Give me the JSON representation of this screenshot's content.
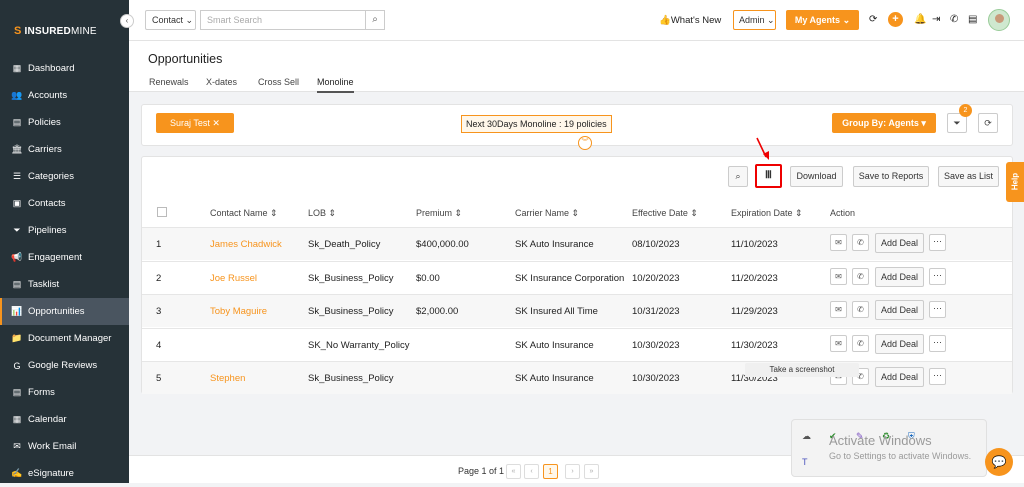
{
  "brand": {
    "mark": "S",
    "name_bold": "INSURED",
    "name_light": "MINE",
    "collapse_icon": "‹"
  },
  "sidebar": {
    "items": [
      {
        "label": "Dashboard",
        "icon": "▦"
      },
      {
        "label": "Accounts",
        "icon": "👥"
      },
      {
        "label": "Policies",
        "icon": "▤"
      },
      {
        "label": "Carriers",
        "icon": "🏛"
      },
      {
        "label": "Categories",
        "icon": "☰"
      },
      {
        "label": "Contacts",
        "icon": "▣"
      },
      {
        "label": "Pipelines",
        "icon": "⏷"
      },
      {
        "label": "Engagement",
        "icon": "📢"
      },
      {
        "label": "Tasklist",
        "icon": "▤"
      },
      {
        "label": "Opportunities",
        "icon": "📊",
        "active": true
      },
      {
        "label": "Document Manager",
        "icon": "📁"
      },
      {
        "label": "Google Reviews",
        "icon": "G"
      },
      {
        "label": "Forms",
        "icon": "▤"
      },
      {
        "label": "Calendar",
        "icon": "▦"
      },
      {
        "label": "Work Email",
        "icon": "✉"
      },
      {
        "label": "eSignature",
        "icon": "✍"
      }
    ]
  },
  "topbar": {
    "search_type": "Contact",
    "search_placeholder": "Smart Search",
    "whats_new": "👍What's New",
    "role": "Admin",
    "my_agents": "My Agents ⌄",
    "plus": "+"
  },
  "header": {
    "title": "Opportunities",
    "tabs": [
      "Renewals",
      "X-dates",
      "Cross Sell",
      "Monoline"
    ],
    "active_tab": "Monoline"
  },
  "filters": {
    "chip": "Suraj Test ✕",
    "info": "Next 30Days  Monoline : 19 policies",
    "group_by": "Group By: Agents ▾",
    "filter_count": "2",
    "chevron": "︾"
  },
  "toolbar": {
    "download": "Download",
    "save_reports": "Save to Reports",
    "save_list": "Save as List",
    "columns_icon": "Ⅲ"
  },
  "table": {
    "headers": [
      "Contact Name ⇕",
      "LOB ⇕",
      "Premium ⇕",
      "Carrier Name ⇕",
      "Effective Date ⇕",
      "Expiration Date ⇕",
      "Action"
    ],
    "rows": [
      {
        "num": "1",
        "contact": "James Chadwick",
        "lob": "Sk_Death_Policy",
        "premium": "$400,000.00",
        "carrier": "SK Auto Insurance",
        "effective": "08/10/2023",
        "expiration": "11/10/2023"
      },
      {
        "num": "2",
        "contact": "Joe Russel",
        "lob": "Sk_Business_Policy",
        "premium": "$0.00",
        "carrier": "SK Insurance Corporation",
        "effective": "10/20/2023",
        "expiration": "11/20/2023"
      },
      {
        "num": "3",
        "contact": "Toby Maguire",
        "lob": "Sk_Business_Policy",
        "premium": "$2,000.00",
        "carrier": "SK Insured All Time",
        "effective": "10/31/2023",
        "expiration": "11/29/2023"
      },
      {
        "num": "4",
        "contact": "",
        "lob": "SK_No Warranty_Policy",
        "premium": "",
        "carrier": "SK Auto Insurance",
        "effective": "10/30/2023",
        "expiration": "11/30/2023"
      },
      {
        "num": "5",
        "contact": "Stephen",
        "lob": "Sk_Business_Policy",
        "premium": "",
        "carrier": "SK Auto Insurance",
        "effective": "10/30/2023",
        "expiration": "11/30/2023"
      }
    ],
    "add_deal": "Add Deal",
    "more": "···"
  },
  "pagination": {
    "text": "Page 1 of 1",
    "first": "«",
    "prev": "‹",
    "current": "1",
    "next": "›",
    "last": "»"
  },
  "help": "Help",
  "tooltip": "Take a screenshot",
  "activate": {
    "title": "Activate Windows",
    "subtitle": "Go to Settings to activate Windows."
  }
}
